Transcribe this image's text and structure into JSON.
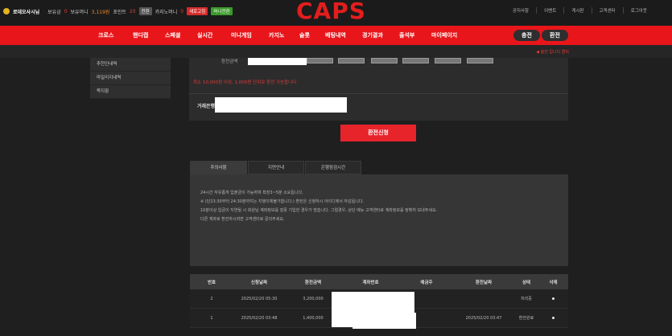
{
  "header": {
    "username": "로데오사시님",
    "holdings_label": "보유금",
    "holdings_value": "0",
    "balance_label": "보유머니",
    "balance_value": "3,119원",
    "points_label": "포인트",
    "points_value": "20",
    "convert_label": "전환",
    "casino_label": "카지노머니",
    "casino_value": "0",
    "refresh_label": "새로고침",
    "recharge_label": "머니전환",
    "logo": "CAPS",
    "links": [
      "공지사항",
      "이벤트",
      "게시판",
      "고객센터",
      "로그아웃"
    ]
  },
  "nav": {
    "items": [
      "크로스",
      "핸디캡",
      "스페셜",
      "실시간",
      "미니게임",
      "카지노",
      "슬롯",
      "베팅내역",
      "경기결과",
      "출석부",
      "마이페이지"
    ],
    "deposit_label": "충전",
    "withdraw_label": "환전"
  },
  "notice_link": "◀ 충전 입니다 클릭",
  "sidebar": {
    "items": [
      "추천인내역",
      "마일리지내역",
      "쪽지함"
    ]
  },
  "form": {
    "amount_label": "환전금액",
    "warning": "최소 10,000원 이상, 1,000원 단위로 환전 가능합니다.",
    "bank_label": "거래은행",
    "submit_label": "환전신청"
  },
  "tabs": {
    "items": [
      "주의사항",
      "지연안내",
      "은행점검시간"
    ],
    "content_lines": [
      "24시간 자유롭게 입출금이 가능하며 최장3~5분 소요됩니다.",
      "※ (단23:30부터 24:30분까지는 지행이체불가합니다.) 환전은 신청하시 아이디에서 자감됩니다.",
      "10분이상 입금이 지연될 시 회원님 계좌정보를 잘못 기입한 경우가 많습니다. 그럴경우, 상단 메뉴 고객센터로 계좌정보를 정확히 보내주세요.",
      "다른 계좌로 환전하시려면 고객센터로 문의주세요."
    ]
  },
  "table": {
    "headers": [
      "번호",
      "신청날짜",
      "환전금액",
      "계좌번호",
      "예금주",
      "환전날짜",
      "상태",
      "삭제"
    ],
    "rows": [
      {
        "no": "2",
        "date": "2025/02/20 05:30",
        "amount": "3,200,000",
        "account": "",
        "holder": "",
        "done_date": "",
        "status": "처리중"
      },
      {
        "no": "1",
        "date": "2025/02/20 03:48",
        "amount": "1,400,000",
        "account": "",
        "holder": "",
        "done_date": "2025/02/20 03:47",
        "status": "환전완료"
      }
    ]
  }
}
